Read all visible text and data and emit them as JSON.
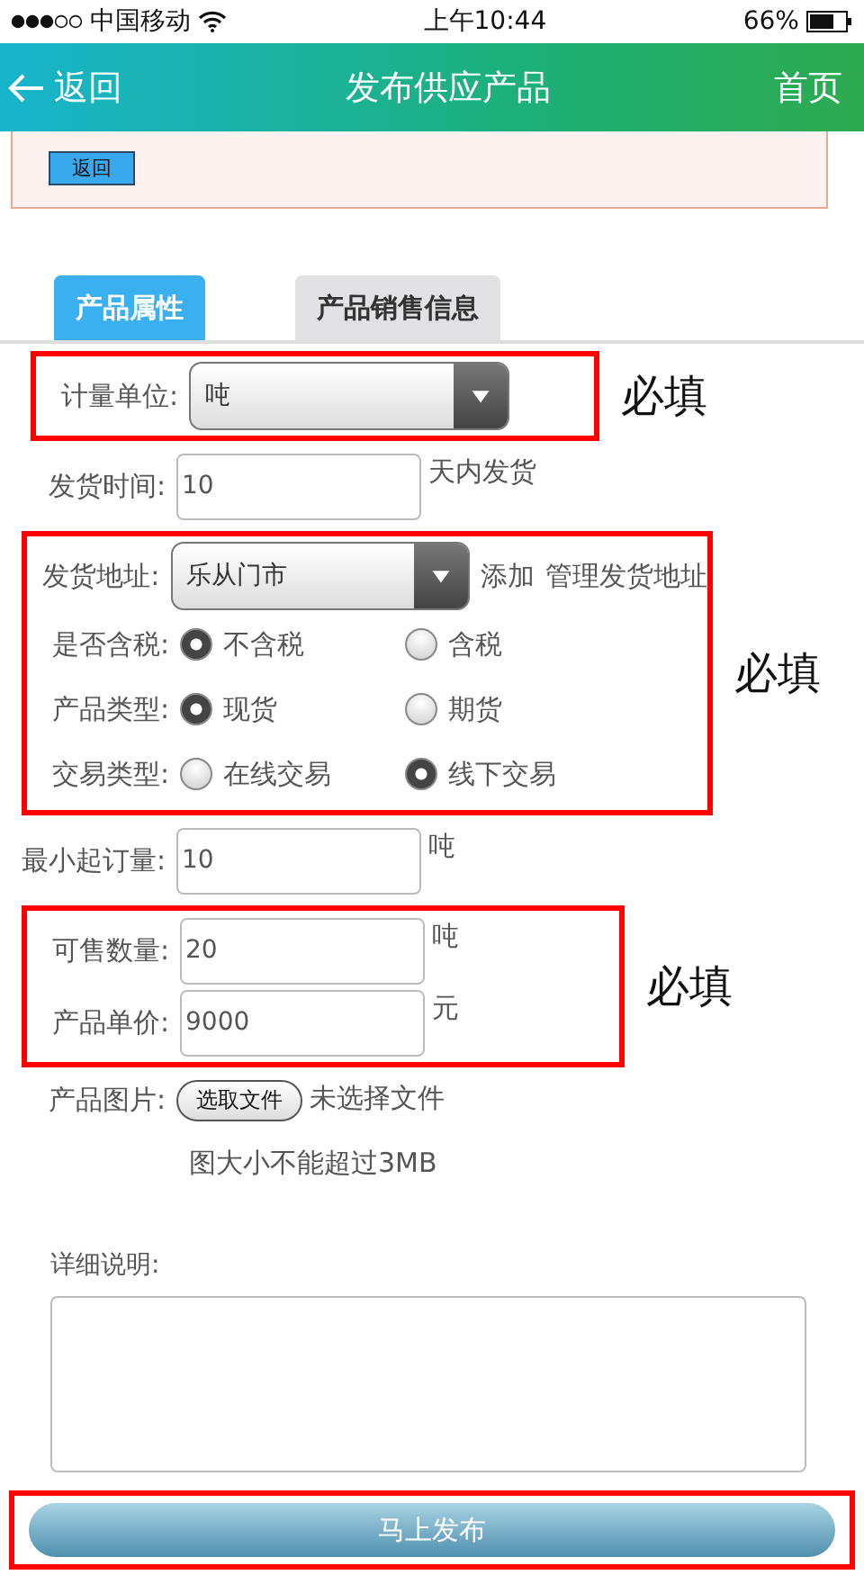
{
  "status_bar": {
    "carrier": "中国移动",
    "time": "上午10:44",
    "battery": "66%"
  },
  "nav": {
    "back": "返回",
    "title": "发布供应产品",
    "home": "首页"
  },
  "notice": {
    "button": "返回"
  },
  "tabs": [
    {
      "label": "产品属性",
      "selected": true
    },
    {
      "label": "产品销售信息",
      "selected": false
    }
  ],
  "blocks": [
    {
      "kind": "annotated",
      "note": "必填",
      "rows": [
        {
          "kind": "select",
          "label": "计量单位:",
          "value": "吨"
        }
      ]
    },
    {
      "kind": "plain",
      "rows": [
        {
          "kind": "input",
          "label": "发货时间:",
          "value": "10",
          "suffix": "天内发货"
        }
      ]
    },
    {
      "kind": "annotated",
      "note": "必填",
      "rows": [
        {
          "kind": "select",
          "label": "发货地址:",
          "value": "乐从门市",
          "links": [
            "添加",
            "管理发货地址"
          ]
        },
        {
          "kind": "radio",
          "label": "是否含税:",
          "options": [
            {
              "label": "不含税",
              "selected": true
            },
            {
              "label": "含税",
              "selected": false
            }
          ]
        },
        {
          "kind": "radio",
          "label": "产品类型:",
          "options": [
            {
              "label": "现货",
              "selected": true
            },
            {
              "label": "期货",
              "selected": false
            }
          ]
        },
        {
          "kind": "radio",
          "label": "交易类型:",
          "options": [
            {
              "label": "在线交易",
              "selected": false
            },
            {
              "label": "线下交易",
              "selected": true
            }
          ]
        }
      ]
    },
    {
      "kind": "plain",
      "rows": [
        {
          "kind": "input",
          "label": "最小起订量:",
          "value": "10",
          "suffix": "吨"
        }
      ]
    },
    {
      "kind": "annotated",
      "note": "必填",
      "rows": [
        {
          "kind": "input",
          "label": "可售数量:",
          "value": "20",
          "suffix": "吨"
        },
        {
          "kind": "input",
          "label": "产品单价:",
          "value": "9000",
          "suffix": "元"
        }
      ]
    },
    {
      "kind": "plain",
      "rows": [
        {
          "kind": "file",
          "label": "产品图片:",
          "button": "选取文件",
          "status": "未选择文件"
        },
        {
          "kind": "hint",
          "text": "图大小不能超过3MB"
        }
      ]
    }
  ],
  "details": {
    "label": "详细说明:"
  },
  "submit": {
    "label": "马上发布",
    "note_box": true
  }
}
